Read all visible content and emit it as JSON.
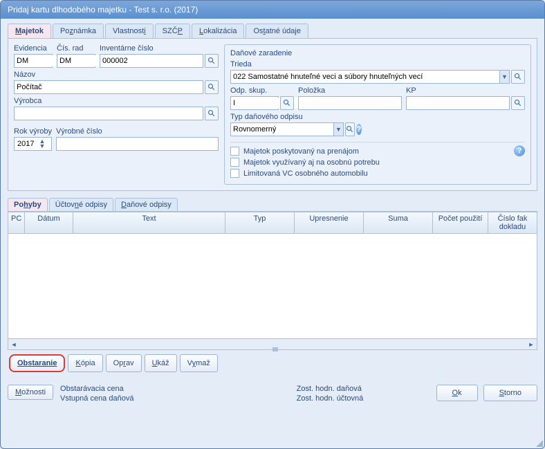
{
  "window": {
    "title": "Pridaj kartu dlhodobého majetku - Test s. r.o. (2017)"
  },
  "tabs": {
    "main": [
      "Majetok",
      "Poznámka",
      "Vlastnosti",
      "SZČP",
      "Lokalizácia",
      "Ostatné údaje"
    ],
    "active": 0
  },
  "left": {
    "evidencia_label": "Evidencia",
    "evidencia_value": "DM",
    "cis_rad_label": "Čís. rad",
    "cis_rad_value": "DM",
    "inv_cislo_label": "Inventárne číslo",
    "inv_cislo_value": "000002",
    "nazov_label": "Názov",
    "nazov_value": "Počítač",
    "vyrobca_label": "Výrobca",
    "vyrobca_value": "",
    "rok_vyroby_label": "Rok výroby",
    "rok_vyroby_value": "2017",
    "vyrobne_cislo_label": "Výrobné číslo",
    "vyrobne_cislo_value": ""
  },
  "right": {
    "group_title": "Daňové zaradenie",
    "trieda_label": "Trieda",
    "trieda_value": "022 Samostatné hnuteľné veci a súbory hnuteľných vecí",
    "odp_skup_label": "Odp. skup.",
    "odp_skup_value": "I",
    "polozka_label": "Položka",
    "polozka_value": "",
    "kp_label": "KP",
    "kp_value": "",
    "typ_odpisu_label": "Typ daňového odpisu",
    "typ_odpisu_value": "Rovnomerný",
    "chk1": "Majetok poskytovaný na prenájom",
    "chk2": "Majetok využívaný aj na osobnú potrebu",
    "chk3": "Limitovaná VC osobného automobilu"
  },
  "subtabs": {
    "items": [
      "Pohyby",
      "Účtovné odpisy",
      "Daňové odpisy"
    ],
    "active": 0
  },
  "grid": {
    "columns": [
      "PC",
      "Dátum",
      "Text",
      "Typ",
      "Upresnenie",
      "Suma",
      "Počet použití",
      "Číslo fak dokladu"
    ]
  },
  "actions": {
    "obstaranie": "Obstaranie",
    "kopia": "Kópia",
    "oprav": "Oprav",
    "ukaz": "Ukáž",
    "vymaz": "Vymaž"
  },
  "footer": {
    "moznosti": "Možnosti",
    "lbl1": "Obstarávacia cena",
    "lbl2": "Zost. hodn. daňová",
    "lbl3": "Vstupná cena daňová",
    "lbl4": "Zost. hodn. účtovná",
    "ok": "Ok",
    "storno": "Storno"
  }
}
